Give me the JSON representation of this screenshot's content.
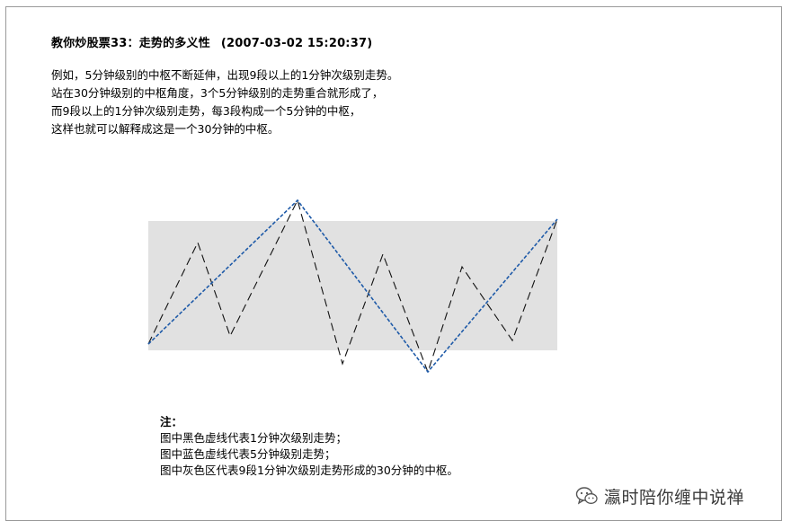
{
  "post": {
    "title": "教你炒股票33：走势的多义性",
    "timestamp": "(2007-03-02 15:20:37)"
  },
  "paragraph": [
    "例如，5分钟级别的中枢不断延伸，出现9段以上的1分钟次级别走势。",
    "站在30分钟级别的中枢角度，3个5分钟级别的走势重合就形成了，",
    "而9段以上的1分钟次级别走势，每3段构成一个5分钟的中枢，",
    "这样也就可以解释成这是一个30分钟的中枢。"
  ],
  "notes": {
    "heading": "注：",
    "lines": [
      "图中黑色虚线代表1分钟次级别走势；",
      "图中蓝色虚线代表5分钟级别走势；",
      "图中灰色区代表9段1分钟次级别走势形成的30分钟的中枢。"
    ]
  },
  "diagram": {
    "zone_color": "#e1e1e1",
    "black_line_color": "#111111",
    "blue_line_color": "#1e5aa8"
  },
  "watermark": {
    "text": "瀛时陪你缠中说禅",
    "icon": "wechat-icon"
  }
}
